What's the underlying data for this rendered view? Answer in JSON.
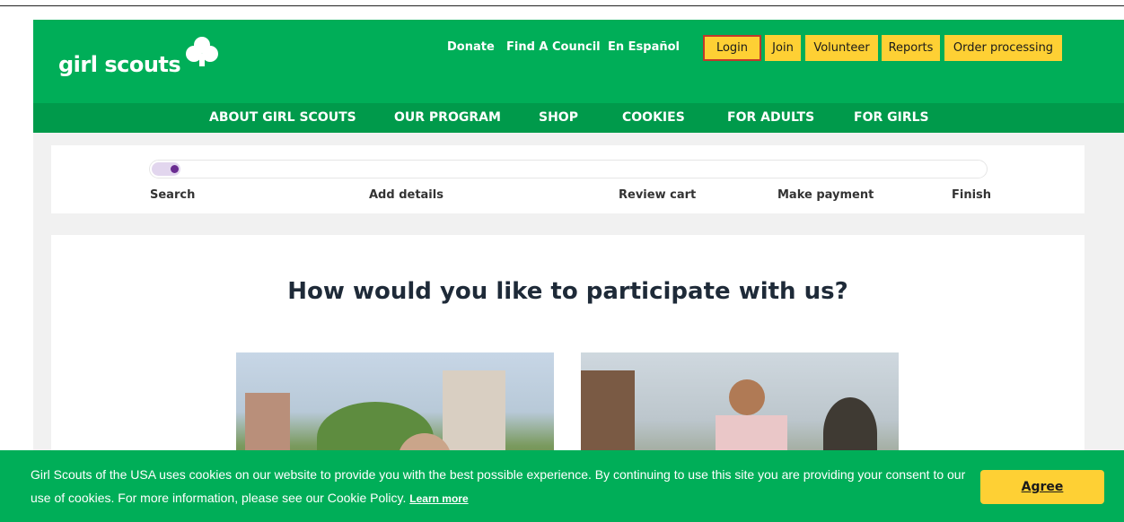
{
  "header": {
    "logo_text": "girl scouts",
    "util_links": {
      "donate": "Donate",
      "find_council": "Find A Council",
      "espanol": "En Español"
    },
    "buttons": {
      "login": "Login",
      "join": "Join",
      "volunteer": "Volunteer",
      "reports": "Reports",
      "order_processing": "Order processing"
    },
    "colors": {
      "green": "#00ae58",
      "nav_green": "#009a4b",
      "yellow": "#fed034"
    }
  },
  "nav": {
    "about": "ABOUT GIRL SCOUTS",
    "program": "OUR PROGRAM",
    "shop": "SHOP",
    "cookies": "COOKIES",
    "adults": "FOR ADULTS",
    "girls": "FOR GIRLS"
  },
  "progress": {
    "steps": {
      "search": "Search",
      "add_details": "Add details",
      "review_cart": "Review cart",
      "make_payment": "Make payment",
      "finish": "Finish"
    },
    "current_step": 1,
    "total_steps": 5,
    "accent": "#6a2c91"
  },
  "main": {
    "heading": "How would you like to participate with us?"
  },
  "cookie_banner": {
    "text": "Girl Scouts of the USA uses cookies on our website to provide you with the best possible experience. By continuing to use this site you are providing your consent to our use of cookies. For more information, please see our Cookie Policy.",
    "learn_more": "Learn more",
    "agree": "Agree"
  }
}
